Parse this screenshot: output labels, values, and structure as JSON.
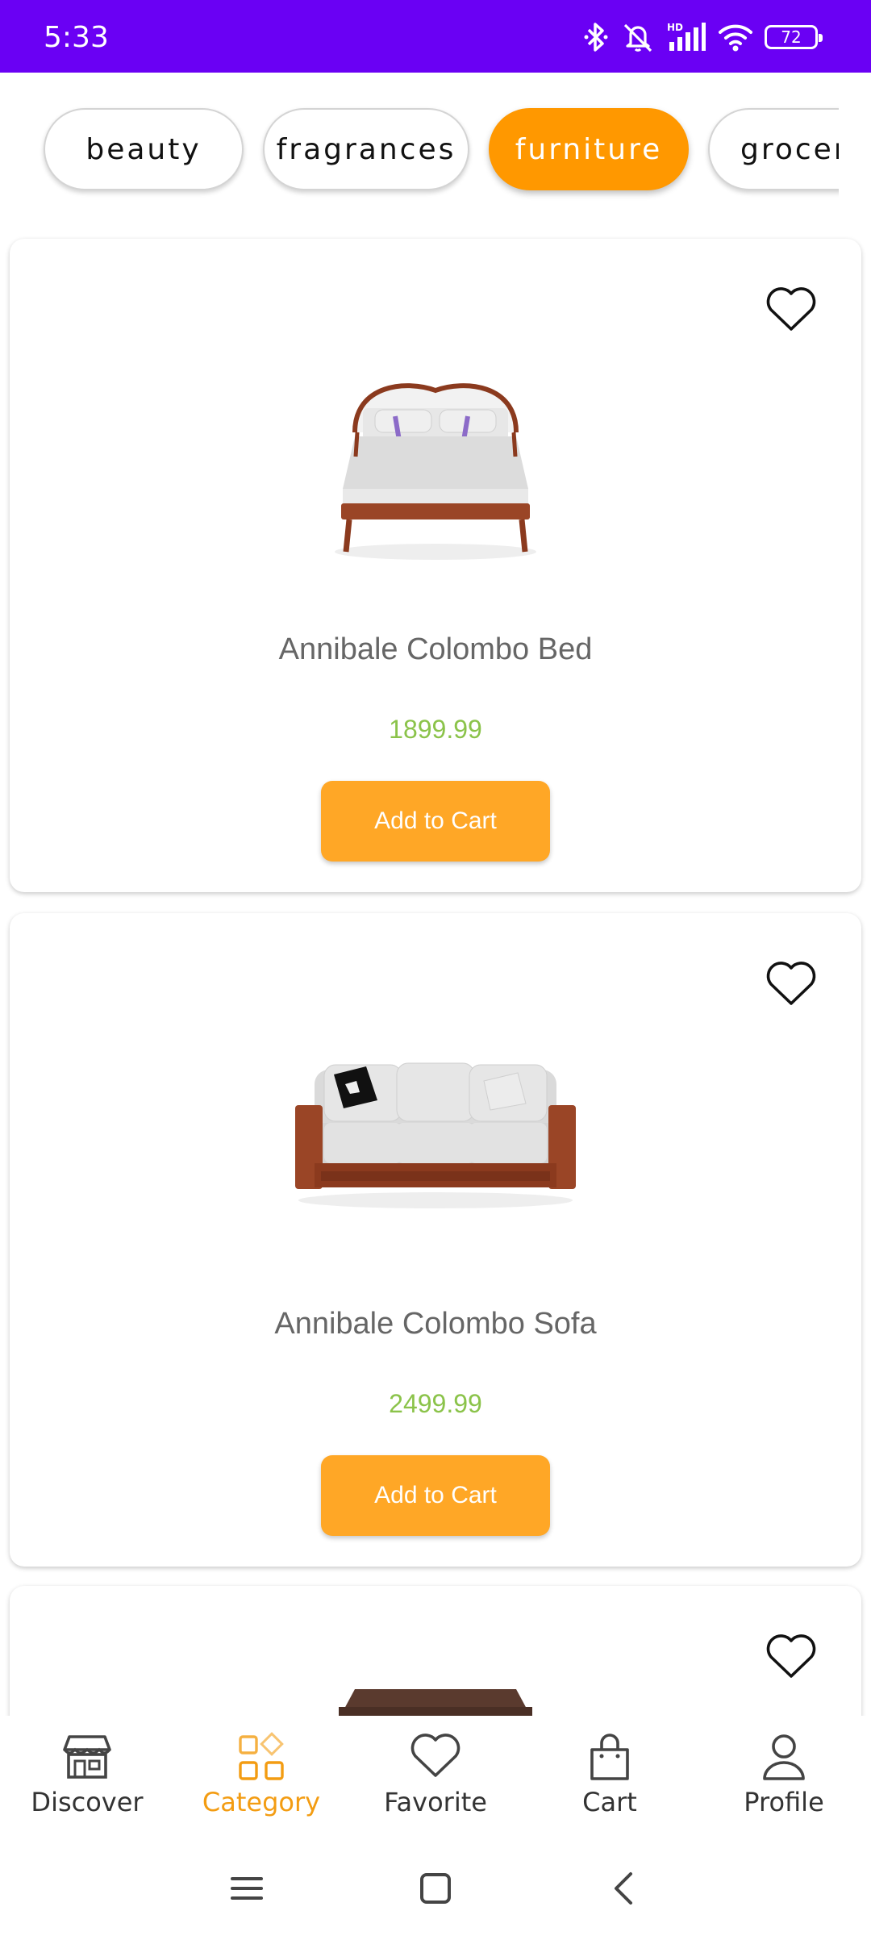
{
  "status_bar": {
    "time": "5:33",
    "battery": "72",
    "icons": [
      "bluetooth-icon",
      "alarm-off-icon",
      "hd-signal-icon",
      "wifi-icon",
      "battery-icon"
    ],
    "background": "#6a00f4"
  },
  "categories": [
    {
      "label": "beauty",
      "active": false
    },
    {
      "label": "fragrances",
      "active": false
    },
    {
      "label": "furniture",
      "active": true
    },
    {
      "label": "grocer",
      "active": false
    }
  ],
  "products": [
    {
      "name": "Annibale Colombo Bed",
      "price": "1899.99",
      "button": "Add to Cart",
      "image": "bed",
      "favorite": false
    },
    {
      "name": "Annibale Colombo Sofa",
      "price": "2499.99",
      "button": "Add to Cart",
      "image": "sofa",
      "favorite": false
    },
    {
      "name": "",
      "price": "",
      "button": "",
      "image": "table",
      "favorite": false
    }
  ],
  "bottom_nav": [
    {
      "label": "Discover",
      "icon": "store-icon",
      "active": false
    },
    {
      "label": "Category",
      "icon": "category-icon",
      "active": true
    },
    {
      "label": "Favorite",
      "icon": "heart-icon",
      "active": false
    },
    {
      "label": "Cart",
      "icon": "bag-icon",
      "active": false
    },
    {
      "label": "Profile",
      "icon": "person-icon",
      "active": false
    }
  ],
  "colors": {
    "accent": "#ff9800",
    "button": "#ffa726",
    "price": "#8bc34a",
    "active_nav": "#f39c12"
  },
  "system_nav": [
    "menu-icon",
    "home-icon",
    "back-icon"
  ]
}
